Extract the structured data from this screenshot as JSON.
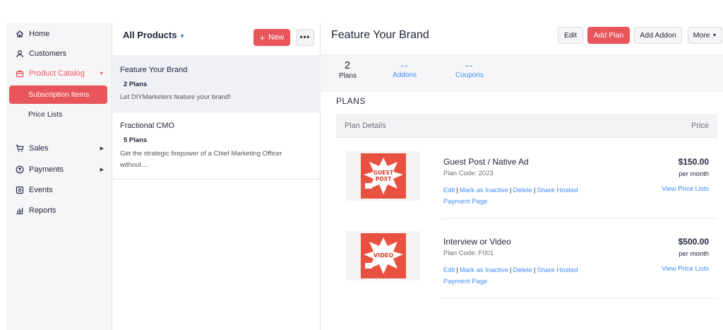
{
  "sidebar": {
    "items": [
      {
        "label": "Home",
        "icon": "home-icon"
      },
      {
        "label": "Customers",
        "icon": "user-icon"
      },
      {
        "label": "Product Catalog",
        "icon": "bag-icon"
      },
      {
        "label": "Sales",
        "icon": "cart-icon"
      },
      {
        "label": "Payments",
        "icon": "payment-icon"
      },
      {
        "label": "Events",
        "icon": "events-icon"
      },
      {
        "label": "Reports",
        "icon": "chart-icon"
      }
    ],
    "sub_items": [
      {
        "label": "Subscription Items"
      },
      {
        "label": "Price Lists"
      }
    ],
    "accent": "#e8565b"
  },
  "products": {
    "title": "All Products",
    "new_label": "New",
    "more_label": "•••",
    "items": [
      {
        "name": "Feature Your Brand",
        "plans": "2 Plans",
        "desc": "Let DIYMarketers feature your brand!"
      },
      {
        "name": "Fractional CMO",
        "plans": "5 Plans",
        "desc": "Get the strategic firepower of a Chief Marketing Officer without...."
      }
    ]
  },
  "detail": {
    "title": "Feature Your Brand",
    "buttons": {
      "edit": "Edit",
      "add_plan": "Add Plan",
      "add_addon": "Add Addon",
      "more": "More"
    },
    "stats": [
      {
        "value": "2",
        "label": "Plans"
      },
      {
        "value": "--",
        "label": "Addons"
      },
      {
        "value": "--",
        "label": "Coupons"
      }
    ],
    "section_title": "PLANS",
    "table_headers": {
      "details": "Plan Details",
      "price": "Price"
    },
    "plans": [
      {
        "name": "Guest Post / Native Ad",
        "code": "Plan Code: 2023",
        "price": "$150.00",
        "freq": "per month",
        "view": "View Price Lists",
        "art_text": "GUEST POST"
      },
      {
        "name": "Interview or Video",
        "code": "Plan Code: F001",
        "price": "$500.00",
        "freq": "per month",
        "view": "View Price Lists",
        "art_text": "VIDEO"
      }
    ],
    "links": {
      "edit": "Edit",
      "inactive": "Mark as Inactive",
      "delete": "Delete",
      "share": "Share Hosted",
      "payment": "Payment Page"
    }
  }
}
